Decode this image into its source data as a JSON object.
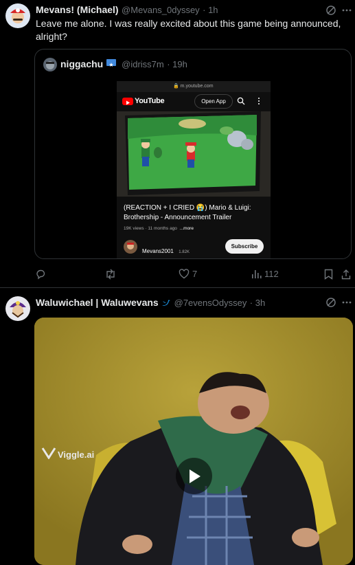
{
  "tweet1": {
    "display_name": "Mevans! (Michael)",
    "handle": "@Mevans_0dyssey",
    "time": "· 1h",
    "text": "Leave me alone. I was really excited about this game being announced, alright?",
    "quote": {
      "display_name": "niggachu",
      "handle": "@idriss7m",
      "time": "· 19h",
      "embed": {
        "url": "m.youtube.com",
        "yt_logo_text": "YouTube",
        "open_app": "Open App",
        "video_title": "(REACTION + I CRIED 😭) Mario & Luigi: Brothership - Announcement Trailer",
        "meta": "19K views · 11 months ago",
        "more": "...more",
        "channel": "Mevans2001",
        "subs": "1.82K",
        "subscribe": "Subscribe"
      }
    },
    "actions": {
      "reply": "",
      "retweet": "",
      "likes": "7",
      "views": "112"
    }
  },
  "tweet2": {
    "display_name": "Waluwichael | Waluwevans",
    "handle": "@7evensOdyssey",
    "time": "· 3h",
    "watermark": "Viggle.ai"
  },
  "colors": {
    "bg": "#000000",
    "text": "#e7e9ea",
    "muted": "#71767b",
    "youtube_red": "#ff0000",
    "verified": "#1d9bf0"
  }
}
